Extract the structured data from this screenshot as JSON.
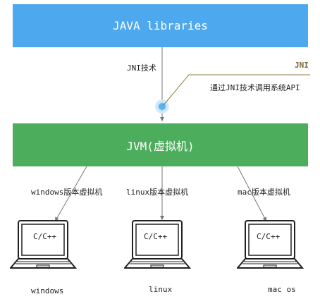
{
  "top_box": {
    "label": "JAVA libraries"
  },
  "middle_box": {
    "label": "JVM(虚拟机)"
  },
  "jni": {
    "arrow_label": "JNI技术",
    "callout_title": "JNI",
    "callout_text": "通过JNI技术调用系统API"
  },
  "platforms": [
    {
      "vm_label": "windows版本虚拟机",
      "screen_text": "C/C++",
      "os_name": "windows"
    },
    {
      "vm_label": "linux版本虚拟机",
      "screen_text": "C/C++",
      "os_name": "linux"
    },
    {
      "vm_label": "mac版本虚拟机",
      "screen_text": "C/C++",
      "os_name": "mac os"
    }
  ],
  "colors": {
    "java_blue": "#4ea8ed",
    "jvm_green": "#4cad5c",
    "callout_line": "#8a7a3a"
  }
}
